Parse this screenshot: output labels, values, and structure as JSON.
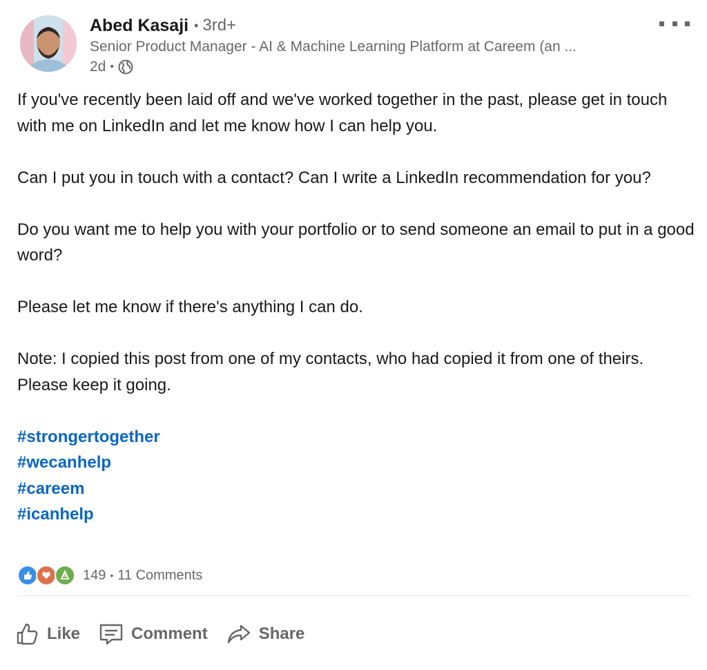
{
  "author": {
    "name": "Abed Kasaji",
    "degree": "3rd+",
    "headline": "Senior Product Manager - AI & Machine Learning Platform at Careem (an ...",
    "timestamp": "2d"
  },
  "post": {
    "paragraphs": [
      "If you've recently been laid off and we've worked together in the past, please get in touch with me on LinkedIn and let me know how I can help you.",
      "Can I put you in touch with a contact? Can I write a LinkedIn recommendation for you?",
      "Do you want me to help you with your portfolio or to send someone an email to put in a good word?",
      "Please let me know if there's anything I can do.",
      "Note: I copied this post from one of my contacts, who had copied it from one of theirs. Please keep it going."
    ],
    "hashtags": [
      "#strongertogether",
      "#wecanhelp",
      "#careem",
      "#icanhelp"
    ]
  },
  "social": {
    "reaction_count": "149",
    "comment_count": "11 Comments",
    "reaction_icons": [
      "like-icon",
      "love-icon",
      "celebrate-icon"
    ]
  },
  "actions": {
    "like": "Like",
    "comment": "Comment",
    "share": "Share"
  },
  "colors": {
    "hashtag": "#0a66c2",
    "like_reaction": "#378fe9",
    "love_reaction": "#df704d",
    "celebrate_reaction": "#6dae4f"
  }
}
